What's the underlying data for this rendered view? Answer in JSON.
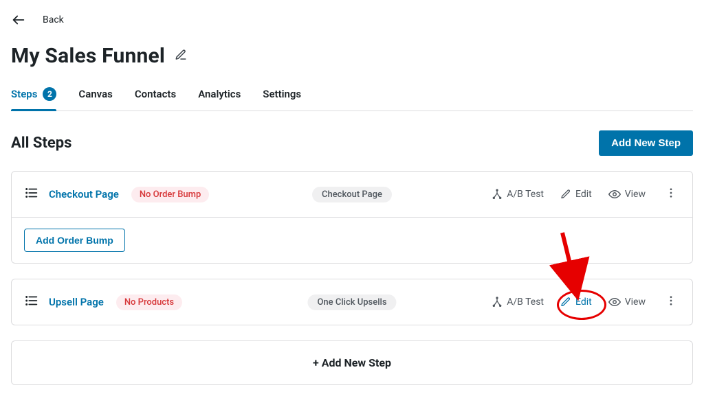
{
  "header": {
    "back_label": "Back",
    "page_title": "My Sales Funnel"
  },
  "tabs": {
    "items": [
      {
        "label": "Steps",
        "count": "2"
      },
      {
        "label": "Canvas"
      },
      {
        "label": "Contacts"
      },
      {
        "label": "Analytics"
      },
      {
        "label": "Settings"
      }
    ]
  },
  "section": {
    "title": "All Steps",
    "add_button": "Add New Step"
  },
  "steps": [
    {
      "name": "Checkout Page",
      "status": "No Order Bump",
      "type": "Checkout Page",
      "actions": {
        "ab": "A/B Test",
        "edit": "Edit",
        "view": "View"
      },
      "sub_button": "Add Order Bump"
    },
    {
      "name": "Upsell Page",
      "status": "No Products",
      "type": "One Click Upsells",
      "actions": {
        "ab": "A/B Test",
        "edit": "Edit",
        "view": "View"
      }
    }
  ],
  "footer": {
    "add_step": "+  Add New Step"
  },
  "colors": {
    "accent": "#0073aa",
    "danger": "#d63638",
    "annotation": "#e60000"
  }
}
